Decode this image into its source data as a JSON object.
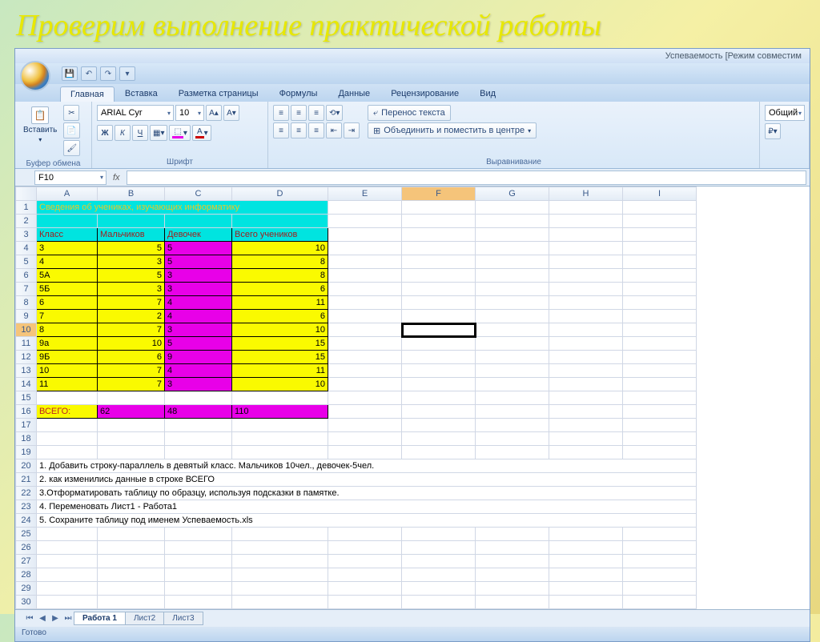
{
  "slide_title": "Проверим выполнение практической работы",
  "window_title": "Успеваемость [Режим совместим",
  "qat": {
    "save": "💾",
    "undo": "↶",
    "redo": "↷"
  },
  "tabs": [
    "Главная",
    "Вставка",
    "Разметка страницы",
    "Формулы",
    "Данные",
    "Рецензирование",
    "Вид"
  ],
  "ribbon": {
    "clipboard": {
      "label": "Буфер обмена",
      "paste": "Вставить"
    },
    "font": {
      "label": "Шрифт",
      "family": "ARIAL Cyr",
      "size": "10",
      "bold": "Ж",
      "italic": "К",
      "underline": "Ч"
    },
    "alignment": {
      "label": "Выравнивание",
      "wrap": "Перенос текста",
      "merge": "Объединить и поместить в центре"
    },
    "number": {
      "label": "Общий"
    }
  },
  "namebox": "F10",
  "fx_label": "fx",
  "columns": [
    "A",
    "B",
    "C",
    "D",
    "E",
    "F",
    "G",
    "H",
    "I"
  ],
  "data": {
    "title": "Сведения об учениках, изучающих информатику",
    "headers": {
      "A": "Класс",
      "B": "Мальчиков",
      "C": "Девочек",
      "D": "Всего учеников"
    },
    "rows": [
      {
        "A": "3",
        "B": "5",
        "C": "5",
        "D": "10"
      },
      {
        "A": "4",
        "B": "3",
        "C": "5",
        "D": "8"
      },
      {
        "A": "5А",
        "B": "5",
        "C": "3",
        "D": "8"
      },
      {
        "A": "5Б",
        "B": "3",
        "C": "3",
        "D": "6"
      },
      {
        "A": "6",
        "B": "7",
        "C": "4",
        "D": "11"
      },
      {
        "A": "7",
        "B": "2",
        "C": "4",
        "D": "6"
      },
      {
        "A": "8",
        "B": "7",
        "C": "3",
        "D": "10"
      },
      {
        "A": "9а",
        "B": "10",
        "C": "5",
        "D": "15"
      },
      {
        "A": "9Б",
        "B": "6",
        "C": "9",
        "D": "15"
      },
      {
        "A": "10",
        "B": "7",
        "C": "4",
        "D": "11"
      },
      {
        "A": "11",
        "B": "7",
        "C": "3",
        "D": "10"
      }
    ],
    "total": {
      "label": "ВСЕГО:",
      "B": "62",
      "C": "48",
      "D": "110"
    },
    "notes": [
      "1. Добавить строку-параллель в девятый  класс. Мальчиков 10чел., девочек-5чел.",
      "2. как изменились данные в строке ВСЕГО",
      "3.Отформатировать таблицу по образцу, используя подсказки в памятке.",
      "4. Переменовать Лист1 -  Работа1",
      "5.  Сохраните таблицу под именем Успеваемость.xls"
    ]
  },
  "sheets": [
    "Работа 1",
    "Лист2",
    "Лист3"
  ],
  "statusbar": "Готово"
}
